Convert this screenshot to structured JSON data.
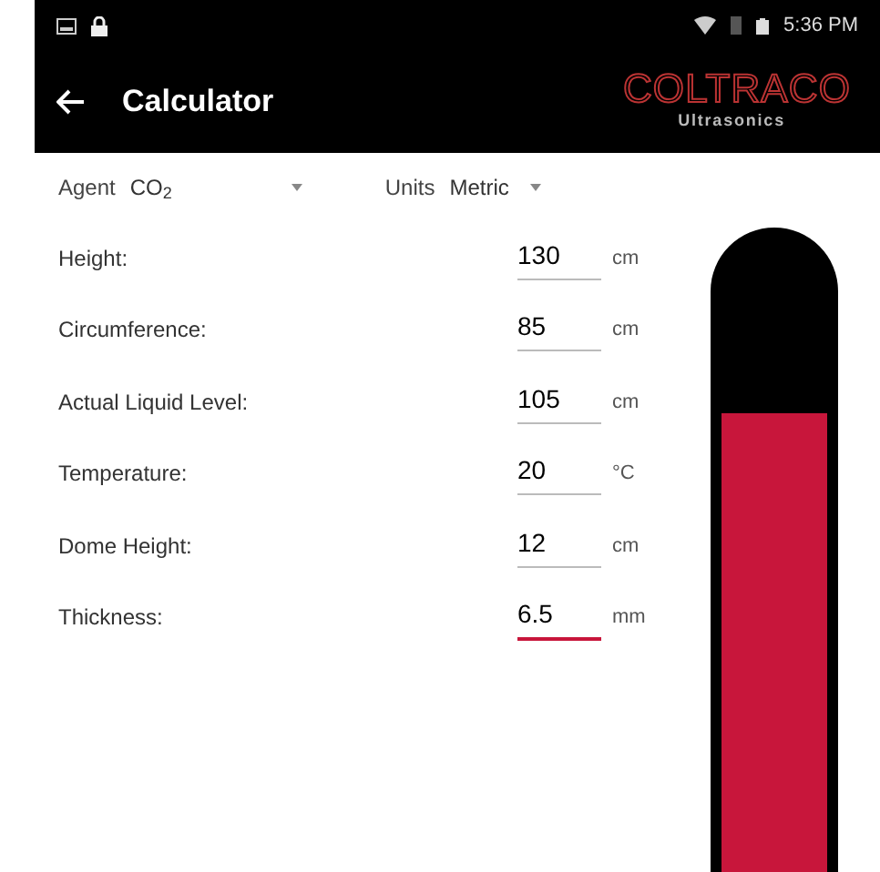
{
  "status_bar": {
    "time": "5:36 PM"
  },
  "app_bar": {
    "title": "Calculator",
    "logo": {
      "name": "COLTRACO",
      "subtitle": "Ultrasonics"
    }
  },
  "selectors": [
    {
      "label": "Agent",
      "value": "CO$_{2}$"
    },
    {
      "label": "Units",
      "value": "Metric"
    }
  ],
  "fields": [
    {
      "label": "Height:",
      "value": "130",
      "unit": "cm",
      "focused": false
    },
    {
      "label": "Circumference:",
      "value": "85",
      "unit": "cm",
      "focused": false
    },
    {
      "label": "Actual Liquid Level:",
      "value": "105",
      "unit": "cm",
      "focused": false
    },
    {
      "label": "Temperature:",
      "value": "20",
      "unit": "°C",
      "focused": false
    },
    {
      "label": "Dome Height:",
      "value": "12",
      "unit": "cm",
      "focused": false
    },
    {
      "label": "Thickness:",
      "value": "6.5",
      "unit": "mm",
      "focused": true
    }
  ],
  "tank": {
    "level": 0.73
  }
}
